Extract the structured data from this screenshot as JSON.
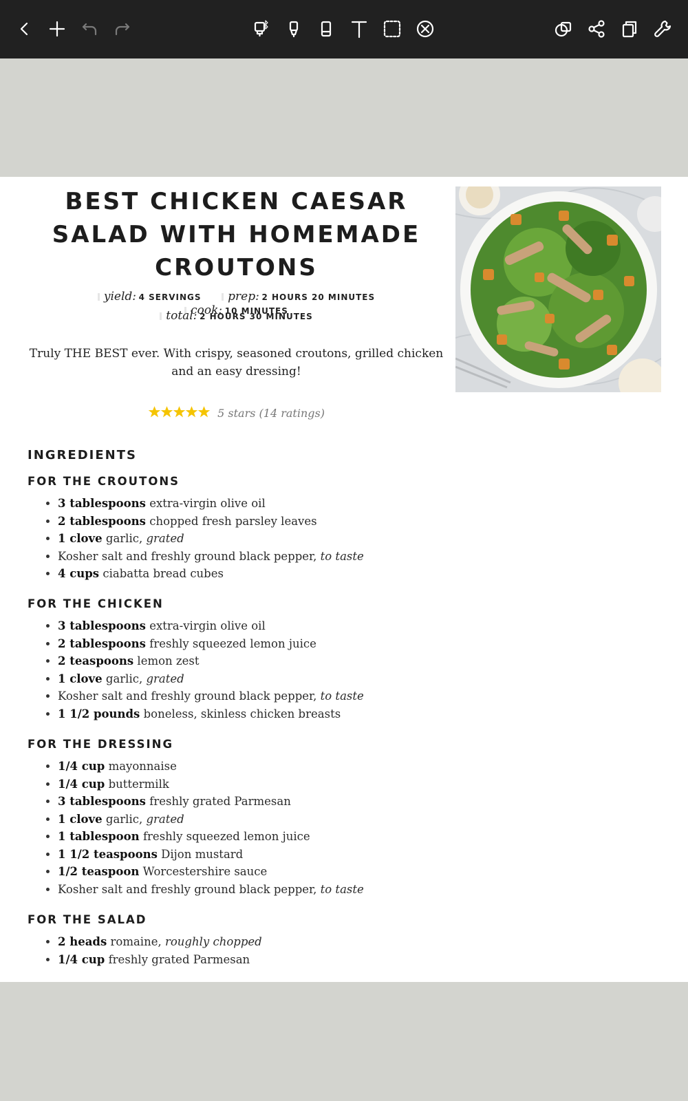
{
  "toolbar": {
    "left": [
      "back-icon",
      "plus-icon",
      "undo-icon",
      "redo-icon"
    ],
    "center": [
      "highlighter-bluetooth-icon",
      "marker-icon",
      "eraser-icon",
      "text-icon",
      "selection-box-icon",
      "close-circle-icon"
    ],
    "right": [
      "layers-icon",
      "share-icon",
      "copy-icon",
      "wrench-icon"
    ]
  },
  "recipe": {
    "title": "BEST CHICKEN CAESAR SALAD WITH HOMEMADE CROUTONS",
    "meta": {
      "yield_label": "yield:",
      "yield_value": "4 SERVINGS",
      "prep_label": "prep:",
      "prep_value": "2 HOURS 20 MINUTES",
      "cook_label": "cook:",
      "cook_value": "10 MINUTES",
      "total_label": "total:",
      "total_value": "2 HOURS 30 MINUTES"
    },
    "description": "Truly THE BEST ever. With crispy, seasoned croutons, grilled chicken and an easy dressing!",
    "rating": {
      "stars": 5,
      "text": "5 stars (14 ratings)",
      "star_color": "#f5c400"
    },
    "image_alt": "Chicken Caesar salad in a large white bowl"
  },
  "ingredients": {
    "heading": "INGREDIENTS",
    "sections": [
      {
        "title": "FOR THE CROUTONS",
        "items": [
          {
            "qty": "3 tablespoons",
            "name": "extra-virgin olive oil",
            "note": ""
          },
          {
            "qty": "2 tablespoons",
            "name": "chopped fresh parsley leaves",
            "note": ""
          },
          {
            "qty": "1 clove",
            "name": "garlic,",
            "note": "grated"
          },
          {
            "qty": "",
            "name": "Kosher salt and freshly ground black pepper,",
            "note": "to taste"
          },
          {
            "qty": "4 cups",
            "name": "ciabatta bread cubes",
            "note": ""
          }
        ]
      },
      {
        "title": "FOR THE CHICKEN",
        "items": [
          {
            "qty": "3 tablespoons",
            "name": "extra-virgin olive oil",
            "note": ""
          },
          {
            "qty": "2 tablespoons",
            "name": "freshly squeezed lemon juice",
            "note": ""
          },
          {
            "qty": "2 teaspoons",
            "name": "lemon zest",
            "note": ""
          },
          {
            "qty": "1 clove",
            "name": "garlic,",
            "note": "grated"
          },
          {
            "qty": "",
            "name": "Kosher salt and freshly ground black pepper,",
            "note": "to taste"
          },
          {
            "qty": "1 1/2 pounds",
            "name": "boneless, skinless chicken breasts",
            "note": ""
          }
        ]
      },
      {
        "title": "FOR THE DRESSING",
        "items": [
          {
            "qty": "1/4 cup",
            "name": "mayonnaise",
            "note": ""
          },
          {
            "qty": "1/4 cup",
            "name": "buttermilk",
            "note": ""
          },
          {
            "qty": "3 tablespoons",
            "name": "freshly grated Parmesan",
            "note": ""
          },
          {
            "qty": "1 clove",
            "name": "garlic,",
            "note": "grated"
          },
          {
            "qty": "1 tablespoon",
            "name": "freshly squeezed lemon juice",
            "note": ""
          },
          {
            "qty": "1 1/2 teaspoons",
            "name": "Dijon mustard",
            "note": ""
          },
          {
            "qty": "1/2 teaspoon",
            "name": "Worcestershire sauce",
            "note": ""
          },
          {
            "qty": "",
            "name": "Kosher salt and freshly ground black pepper,",
            "note": "to taste"
          }
        ]
      },
      {
        "title": "FOR THE SALAD",
        "items": [
          {
            "qty": "2 heads",
            "name": "romaine,",
            "note": "roughly chopped"
          },
          {
            "qty": "1/4 cup",
            "name": "freshly grated Parmesan",
            "note": ""
          }
        ]
      }
    ]
  }
}
